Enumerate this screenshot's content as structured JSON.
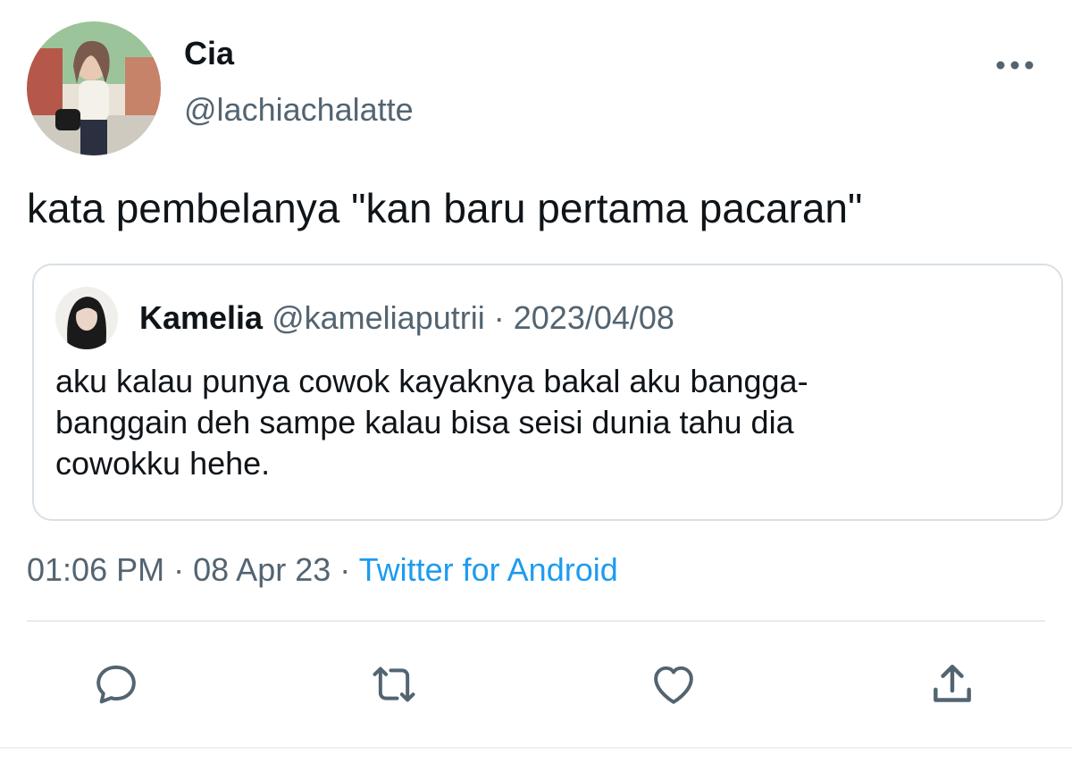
{
  "tweet": {
    "author": {
      "name": "Cia",
      "handle": "@lachiachalatte"
    },
    "text": "kata pembelanya \"kan baru pertama pacaran\"",
    "quoted": {
      "name": "Kamelia",
      "handle": "@kameliaputrii",
      "separator": "·",
      "date": "2023/04/08",
      "text_lines": [
        "aku kalau punya cowok kayaknya bakal aku bangga-",
        "banggain deh sampe kalau bisa seisi dunia tahu dia",
        "cowokku hehe."
      ]
    },
    "meta": {
      "time": "01:06 PM",
      "separator": "·",
      "date": "08 Apr 23",
      "source": "Twitter for Android"
    }
  },
  "actions": [
    {
      "icon": "reply-icon"
    },
    {
      "icon": "retweet-icon"
    },
    {
      "icon": "like-icon"
    },
    {
      "icon": "share-icon"
    }
  ],
  "colors": {
    "text": "#0f1419",
    "secondary": "#536471",
    "link": "#1d9bf0",
    "border": "#d8e0e6"
  }
}
